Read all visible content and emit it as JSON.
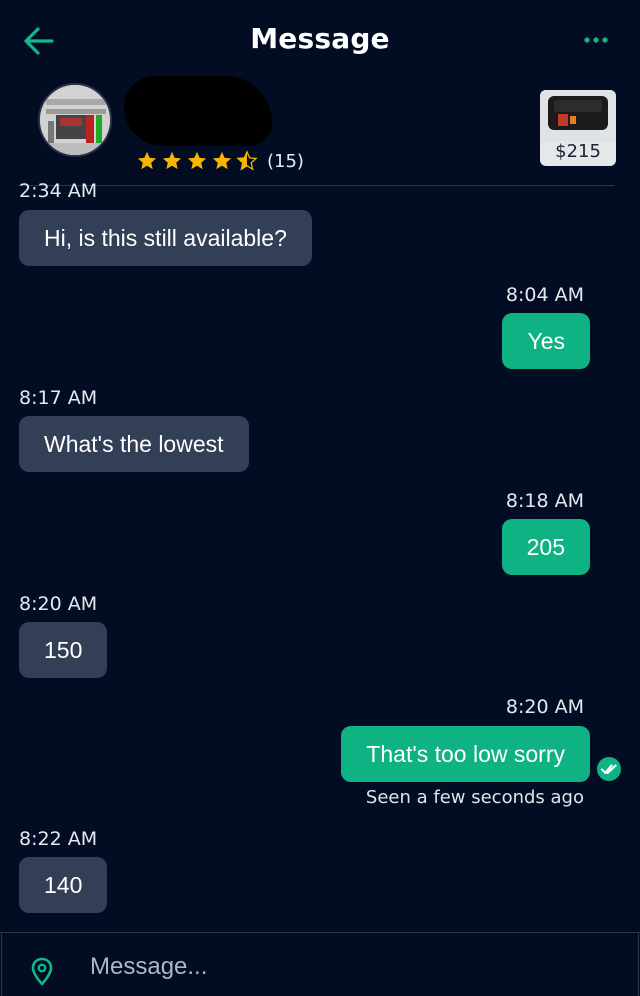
{
  "header": {
    "title": "Message",
    "back_icon": "arrow-left-icon",
    "more_icon": "more-horizontal-icon"
  },
  "seller": {
    "rating": 4.5,
    "rating_count": "(15)",
    "item_price": "$215"
  },
  "messages": [
    {
      "time": "2:34 AM",
      "text": "Hi, is this still available?",
      "direction": "incoming"
    },
    {
      "time": "8:04 AM",
      "text": "Yes",
      "direction": "outgoing"
    },
    {
      "time": "8:17 AM",
      "text": "What's the lowest",
      "direction": "incoming"
    },
    {
      "time": "8:18 AM",
      "text": "205",
      "direction": "outgoing"
    },
    {
      "time": "8:20 AM",
      "text": "150",
      "direction": "incoming"
    },
    {
      "time": "8:20 AM",
      "text": "That's too low sorry",
      "direction": "outgoing"
    },
    {
      "time": "8:22 AM",
      "text": "140",
      "direction": "incoming"
    }
  ],
  "seen_status": "Seen a few seconds ago",
  "composer": {
    "placeholder": "Message...",
    "location_icon": "location-pin-icon"
  },
  "colors": {
    "background": "#020d24",
    "incoming_bubble": "#333f57",
    "outgoing_bubble": "#0fb383",
    "accent": "#12b886",
    "star": "#f7b500"
  }
}
